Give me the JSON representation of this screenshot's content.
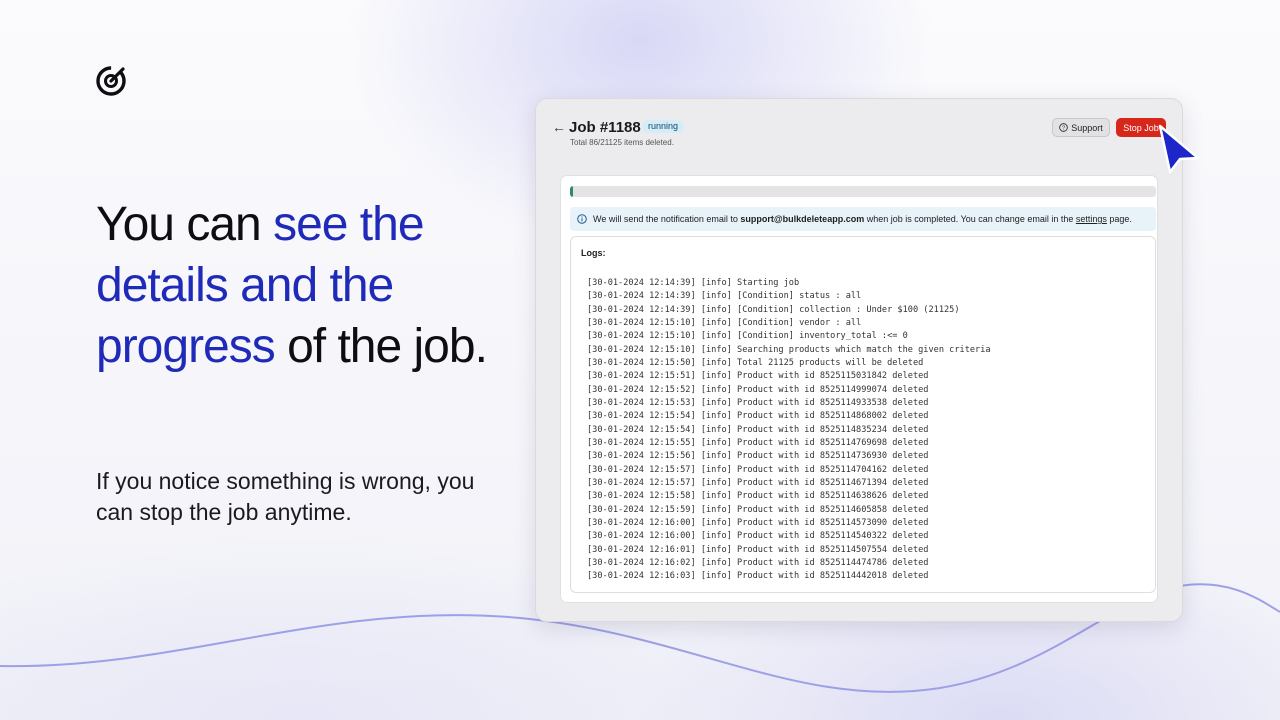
{
  "headline": {
    "part1": "You can ",
    "accent": "see the details and the progress",
    "part2": " of the job."
  },
  "subtext": "If you notice something is wrong, you can stop the job anytime.",
  "job": {
    "title": "Job #1188",
    "status": "running",
    "total_text": "Total 86/21125 items deleted.",
    "support_label": "Support",
    "stop_label": "Stop Job",
    "progress": 0.004
  },
  "notice": {
    "prefix": "We will send the notification email to ",
    "email": "support@bulkdeleteapp.com",
    "middle": " when job is completed. You can change email in the ",
    "link": "settings",
    "suffix": " page."
  },
  "logs": {
    "title": "Logs:",
    "lines": [
      "[30-01-2024 12:14:39] [info] Starting job",
      "[30-01-2024 12:14:39] [info] [Condition] status : all",
      "[30-01-2024 12:14:39] [info] [Condition] collection : Under $100 (21125)",
      "[30-01-2024 12:15:10] [info] [Condition] vendor : all",
      "[30-01-2024 12:15:10] [info] [Condition] inventory_total :<= 0",
      "[30-01-2024 12:15:10] [info] Searching products which match the given criteria",
      "[30-01-2024 12:15:50] [info] Total 21125 products will be deleted",
      "[30-01-2024 12:15:51] [info] Product with id 8525115031842 deleted",
      "[30-01-2024 12:15:52] [info] Product with id 8525114999074 deleted",
      "[30-01-2024 12:15:53] [info] Product with id 8525114933538 deleted",
      "[30-01-2024 12:15:54] [info] Product with id 8525114868002 deleted",
      "[30-01-2024 12:15:54] [info] Product with id 8525114835234 deleted",
      "[30-01-2024 12:15:55] [info] Product with id 8525114769698 deleted",
      "[30-01-2024 12:15:56] [info] Product with id 8525114736930 deleted",
      "[30-01-2024 12:15:57] [info] Product with id 8525114704162 deleted",
      "[30-01-2024 12:15:57] [info] Product with id 8525114671394 deleted",
      "[30-01-2024 12:15:58] [info] Product with id 8525114638626 deleted",
      "[30-01-2024 12:15:59] [info] Product with id 8525114605858 deleted",
      "[30-01-2024 12:16:00] [info] Product with id 8525114573090 deleted",
      "[30-01-2024 12:16:00] [info] Product with id 8525114540322 deleted",
      "[30-01-2024 12:16:01] [info] Product with id 8525114507554 deleted",
      "[30-01-2024 12:16:02] [info] Product with id 8525114474786 deleted",
      "[30-01-2024 12:16:03] [info] Product with id 8525114442018 deleted"
    ]
  },
  "icons": {
    "logo": "target-check-logo-icon",
    "back": "back-arrow-icon",
    "support": "question-circle-icon",
    "info": "info-circle-icon",
    "cursor": "mouse-pointer-icon"
  },
  "colors": {
    "accent": "#1f2bb8",
    "stop_button": "#d7261a",
    "progress": "#2d8a6d",
    "notice_bg": "#e8f2f9",
    "status_bg": "#d6ecf7",
    "cursor": "#1d27c9",
    "wave": "#9ea0e6"
  }
}
